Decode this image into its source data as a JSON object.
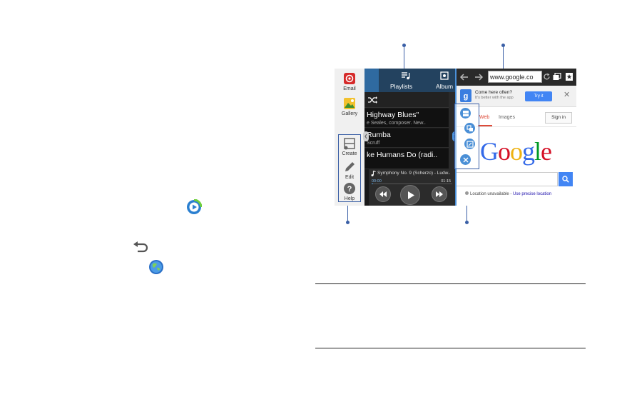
{
  "icons": {
    "music_player_icon": "music-player-icon",
    "back_icon": "back-icon",
    "internet_icon": "internet-icon"
  },
  "tray": {
    "items": [
      {
        "label": "Email",
        "icon": "email-icon"
      },
      {
        "label": "Gallery",
        "icon": "gallery-icon"
      },
      {
        "label": "Create",
        "icon": "create-icon"
      },
      {
        "label": "Edit",
        "icon": "edit-icon"
      },
      {
        "label": "Help",
        "icon": "help-icon"
      }
    ]
  },
  "music": {
    "tabs": [
      {
        "label": "Playlists"
      },
      {
        "label": "Album"
      }
    ],
    "songs": [
      {
        "title": "Highway Blues\"",
        "subtitle": "e Seales, composer. New.."
      },
      {
        "title": "Rumba",
        "subtitle": "Scruff"
      },
      {
        "title": "ke Humans Do (radi..",
        "subtitle": ""
      }
    ],
    "now_playing": {
      "title": "Symphony No. 9 (Scherzo) - Ludw..",
      "elapsed": "00:00",
      "total": "01:15",
      "progress": 0.02
    }
  },
  "browser": {
    "url": "www.google.co",
    "promo_title": "Come here often?",
    "promo_subtitle": "It's better with the app",
    "try_label": "Try it",
    "close_label": "✕",
    "tabs": [
      {
        "label": "Web"
      },
      {
        "label": "Images"
      }
    ],
    "signin_label": "Sign in",
    "logo_letters": [
      {
        "char": "G",
        "color": "#3369e8"
      },
      {
        "char": "o",
        "color": "#d50f25"
      },
      {
        "char": "o",
        "color": "#eeb211"
      },
      {
        "char": "g",
        "color": "#3369e8"
      },
      {
        "char": "l",
        "color": "#009925"
      },
      {
        "char": "e",
        "color": "#d50f25"
      }
    ],
    "location_text": "Location unavailable - ",
    "location_link": "Use precise location"
  },
  "colors": {
    "callout": "#3a5fa6",
    "accent": "#4285f4"
  }
}
